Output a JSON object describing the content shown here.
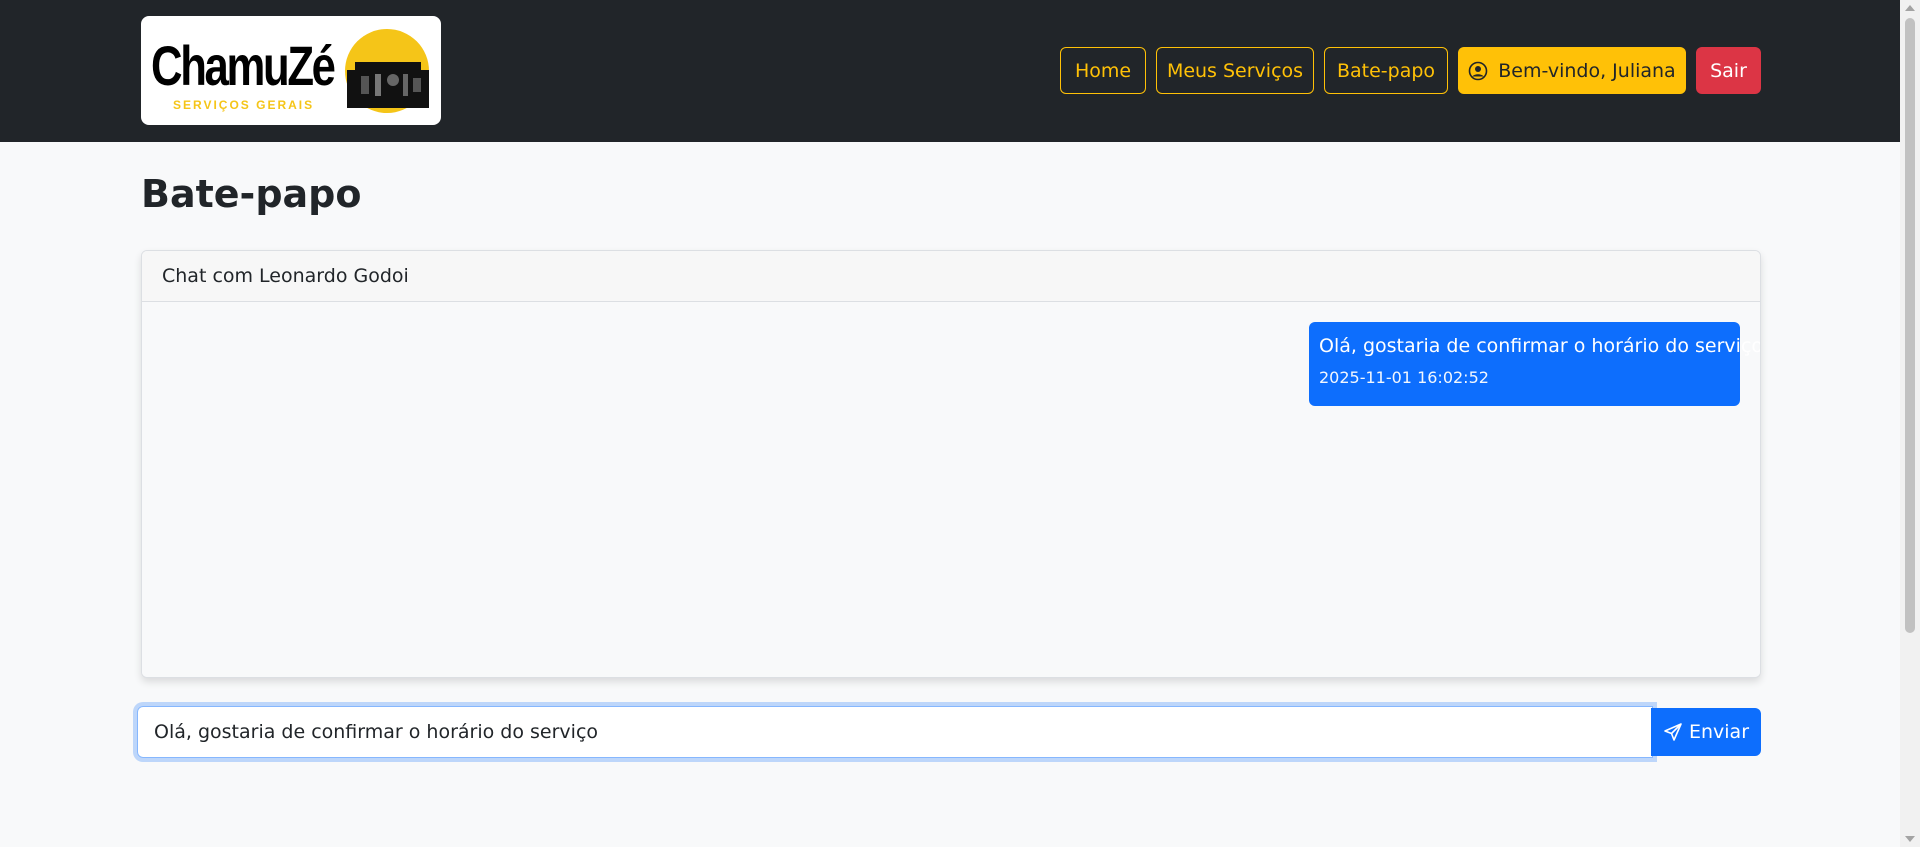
{
  "navbar": {
    "logo": {
      "word": "ChamuZé",
      "tagline": "SERVIÇOS GERAIS"
    },
    "links": {
      "home": "Home",
      "servicos": "Meus Serviços",
      "chat": "Bate-papo"
    },
    "welcome_label": "Bem-vindo, Juliana",
    "welcome_icon": "user-circle-icon",
    "logout_label": "Sair"
  },
  "page": {
    "title": "Bate-papo"
  },
  "chat": {
    "header": "Chat com Leonardo Godoi",
    "messages": [
      {
        "text": "Olá, gostaria de confirmar o horário do serviço",
        "timestamp": "2025-11-01 16:02:52",
        "side": "right"
      }
    ]
  },
  "composer": {
    "value": "Olá, gostaria de confirmar o horário do serviço",
    "send_label": "Enviar",
    "send_icon": "send-icon"
  },
  "colors": {
    "navbar_bg": "#212529",
    "accent_yellow": "#ffc107",
    "danger": "#dc3545",
    "primary": "#0d6efd",
    "page_bg": "#f8f9fa"
  }
}
